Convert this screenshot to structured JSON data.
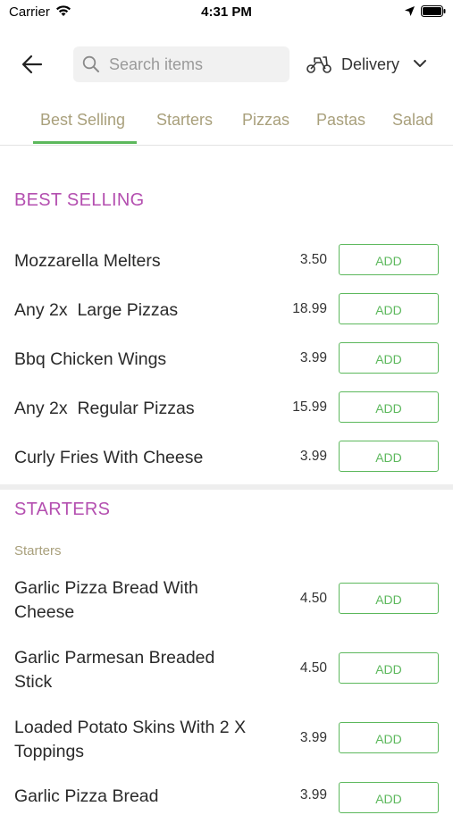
{
  "status_bar": {
    "carrier": "Carrier",
    "time": "4:31 PM",
    "icons": [
      "wifi-icon",
      "location-icon",
      "battery-icon"
    ]
  },
  "header": {
    "back_icon": "arrow-left-icon",
    "search": {
      "placeholder": "Search items",
      "value": "",
      "icon": "search-icon"
    },
    "delivery": {
      "label": "Delivery",
      "icon": "scooter-icon",
      "chevron": "chevron-down-icon"
    }
  },
  "tabs": [
    {
      "label": "Best Selling",
      "active": true
    },
    {
      "label": "Starters",
      "active": false
    },
    {
      "label": "Pizzas",
      "active": false
    },
    {
      "label": "Pastas",
      "active": false
    },
    {
      "label": "Salad",
      "active": false
    }
  ],
  "sections": {
    "best_selling": {
      "title": "BEST SELLING",
      "items": [
        {
          "name": "Mozzarella Melters",
          "price": "3.50",
          "action": "ADD"
        },
        {
          "name": "Any 2x  Large Pizzas",
          "price": "18.99",
          "action": "ADD"
        },
        {
          "name": "Bbq Chicken Wings",
          "price": "3.99",
          "action": "ADD"
        },
        {
          "name": "Any 2x  Regular Pizzas",
          "price": "15.99",
          "action": "ADD"
        },
        {
          "name": "Curly Fries With Cheese",
          "price": "3.99",
          "action": "ADD"
        }
      ]
    },
    "starters": {
      "title": "STARTERS",
      "subtitle": "Starters",
      "items": [
        {
          "name": "Garlic Pizza Bread With\nCheese",
          "price": "4.50",
          "action": "ADD"
        },
        {
          "name": "Garlic Parmesan Breaded\nStick",
          "price": "4.50",
          "action": "ADD"
        },
        {
          "name": "Loaded Potato Skins With 2 X\nToppings",
          "price": "3.99",
          "action": "ADD"
        },
        {
          "name": "Garlic Pizza Bread",
          "price": "3.99",
          "action": "ADD"
        }
      ]
    }
  },
  "colors": {
    "accent_green": "#5cb85c",
    "section_purple": "#b44fb0",
    "tab_text": "#a9a07c"
  }
}
